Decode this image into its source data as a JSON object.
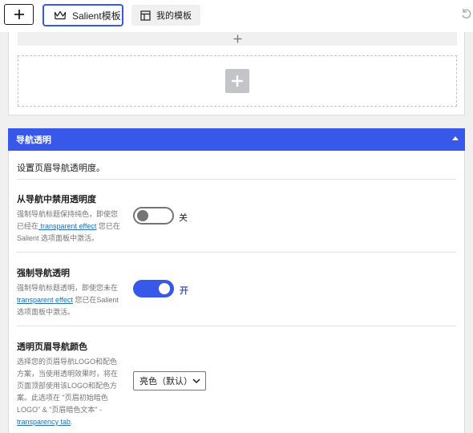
{
  "toolbar": {
    "add_icon": "plus-icon",
    "salient_tab_label": "Salient模板",
    "salient_tab_icon": "crown-icon",
    "my_templates_label": "我的模板",
    "my_templates_icon": "layout-icon",
    "undo_icon": "undo-icon"
  },
  "upper_panel": {
    "add_row_icon": "plus-icon",
    "drop_zone_icon": "plus-icon"
  },
  "section": {
    "title": "导航透明",
    "description": "设置页眉导航透明度。",
    "accent_color": "#3858e9",
    "settings": [
      {
        "title": "从导航中禁用透明度",
        "help_before": "强制导航标题保持纯色，即使您已经在",
        "help_link": " transparent effect",
        "help_after": " 您已在Salient 选项面板中激活。",
        "toggle_on": false,
        "state_label": "关"
      },
      {
        "title": "强制导航透明",
        "help_before": "强制导航标题透明，即使您未在",
        "help_link": "transparent effect",
        "help_after": " 您已在Salient 选项面板中激活。",
        "toggle_on": true,
        "state_label": "开"
      },
      {
        "title": "透明页眉导航颜色",
        "help_before": "选择您的页眉导航LOGO和配色方案，当使用透明效果时，将在页面顶部使用该LOGO和配色方案。此选项在 \"页眉初始暗色 LOGO\" & \"页眉暗色文本\" - ",
        "help_link": "transparency tab",
        "help_after": ".",
        "select_value": "亮色（默认）"
      }
    ]
  }
}
